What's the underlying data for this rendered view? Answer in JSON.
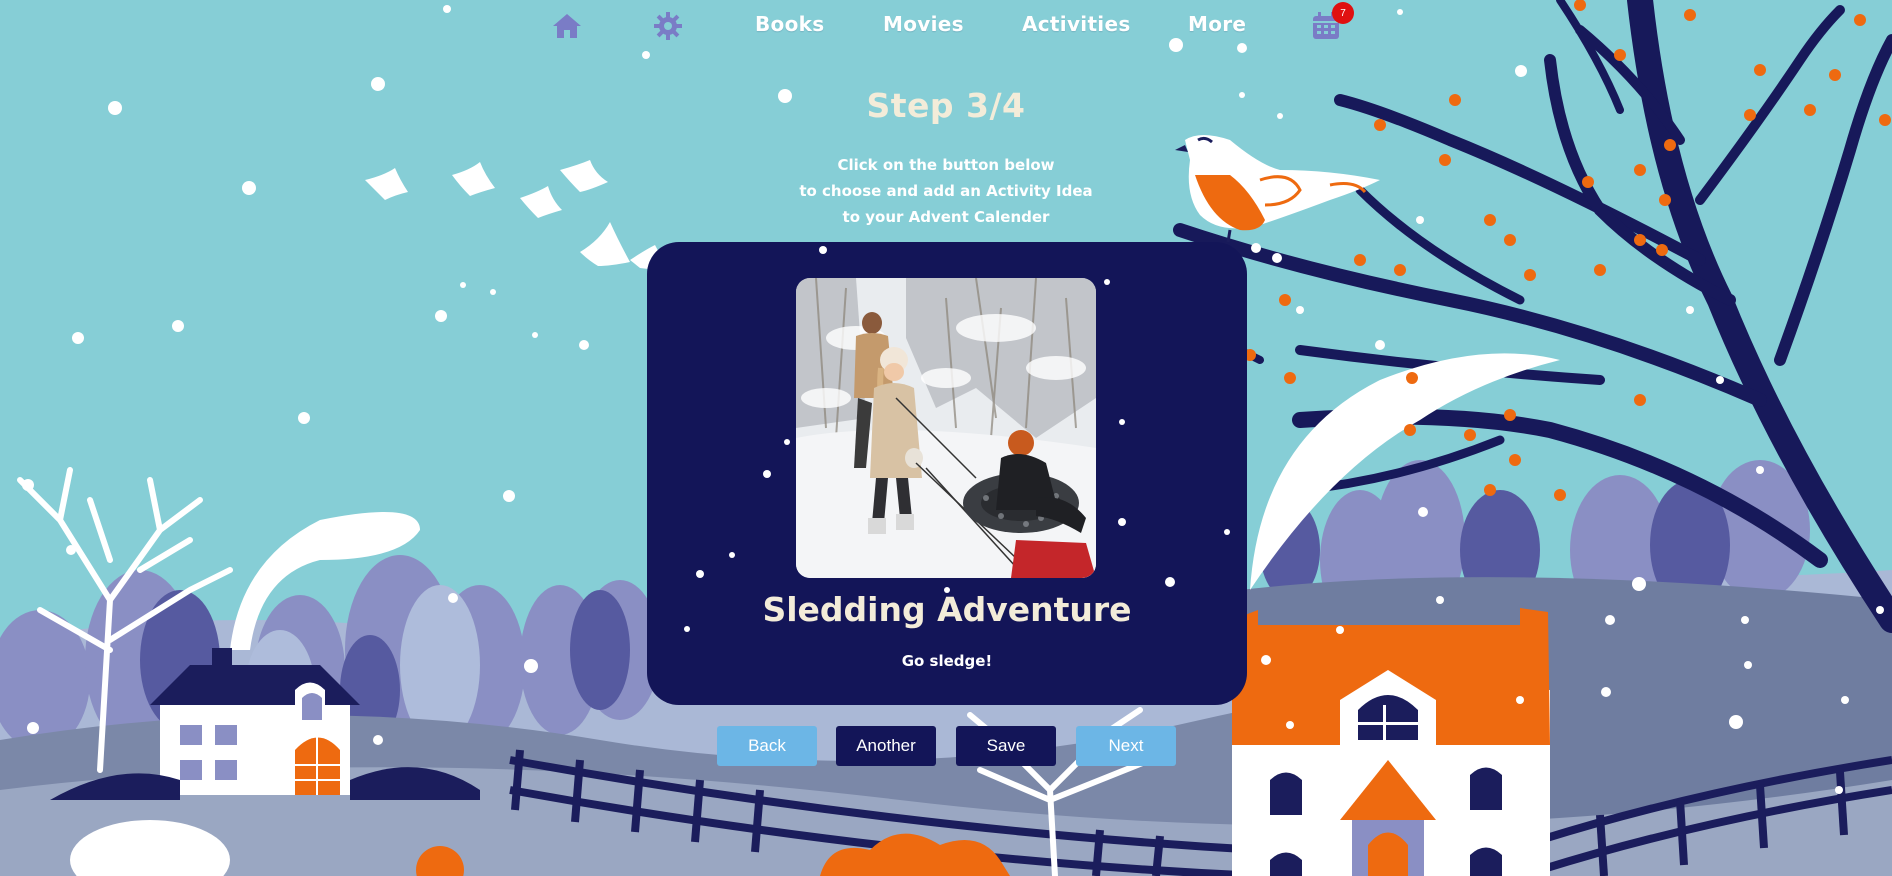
{
  "nav": {
    "links": [
      "Books",
      "Movies",
      "Activities",
      "More"
    ],
    "calendar_badge": "7",
    "icons": [
      "home-icon",
      "gear-icon",
      "calendar-icon"
    ]
  },
  "step": {
    "title": "Step 3/4",
    "instructions": [
      "Click on the button below",
      "to choose and add an Activity Idea",
      "to your Advent Calender"
    ]
  },
  "card": {
    "title": "Sledding Adventure",
    "subtitle": "Go sledge!"
  },
  "buttons": {
    "back": "Back",
    "another": "Another",
    "save": "Save",
    "next": "Next"
  },
  "colors": {
    "sky": "#86ced6",
    "card": "#131558",
    "navy": "#1b1d5c",
    "orange": "#ee6a10",
    "light_button": "#6cb6e6",
    "dark_button": "#131558"
  }
}
